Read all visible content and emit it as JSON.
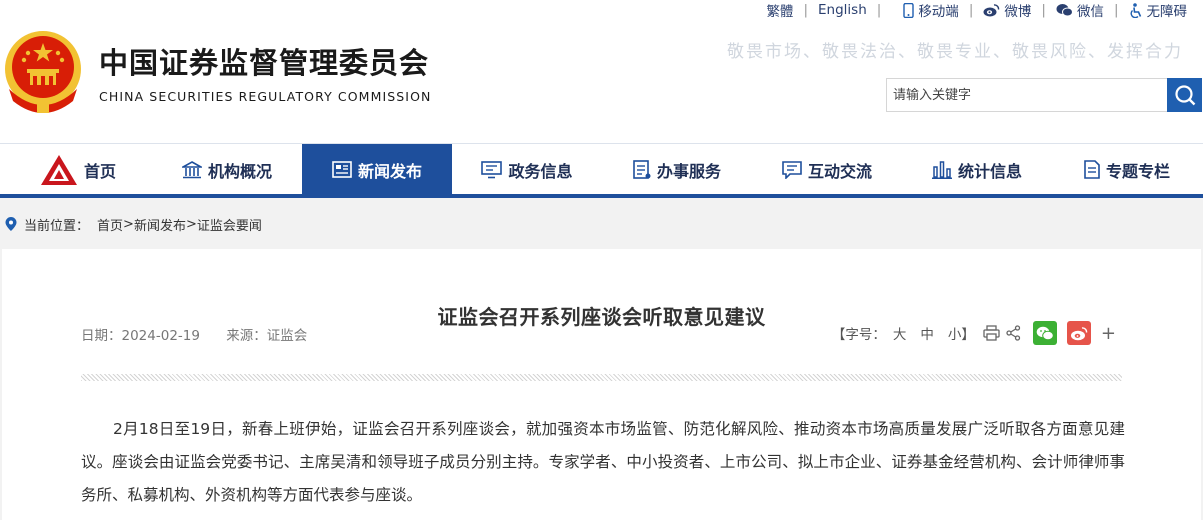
{
  "site": {
    "name_cn": "中国证券监督管理委员会",
    "name_en": "CHINA SECURITIES REGULATORY COMMISSION",
    "slogan": "敬畏市场、敬畏法治、敬畏专业、敬畏风险、发挥合力"
  },
  "toplinks": {
    "traditional": "繁體",
    "english": "English",
    "mobile": "移动端",
    "weibo": "微博",
    "wechat": "微信",
    "accessibility": "无障碍"
  },
  "search": {
    "placeholder": "请输入关键字"
  },
  "nav": {
    "home": "首页",
    "org": "机构概况",
    "news": "新闻发布",
    "gov": "政务信息",
    "service": "办事服务",
    "interact": "互动交流",
    "stats": "统计信息",
    "topics": "专题专栏",
    "active": "新闻发布"
  },
  "breadcrumb": {
    "label": "当前位置：",
    "home": "首页",
    "sep": ">",
    "news": "新闻发布",
    "current": "证监会要闻"
  },
  "article": {
    "title": "证监会召开系列座谈会听取意见建议",
    "date": "日期：2024-02-19",
    "source": "来源：证监会",
    "font_label": "【字号：",
    "font_large": "大",
    "font_medium": "中",
    "font_small": "小】",
    "more": "+",
    "paragraph": "2月18日至19日，新春上班伊始，证监会召开系列座谈会，就加强资本市场监管、防范化解风险、推动资本市场高质量发展广泛听取各方面意见建议。座谈会由证监会党委书记、主席吴清和领导班子成员分别主持。专家学者、中小投资者、上市公司、拟上市企业、证券基金经营机构、会计师律师事务所、私募机构、外资机构等方面代表参与座谈。"
  },
  "colors": {
    "nav_active": "#1e4f9c",
    "search_button": "#1f5fb0",
    "emblem_red": "#d81e06",
    "emblem_gold": "#f2c233",
    "wechat_green": "#3cb034",
    "weibo_red": "#e6544a"
  },
  "icons": [
    "national-emblem-icon",
    "mobile-icon",
    "weibo-icon",
    "wechat-icon",
    "accessibility-icon",
    "search-icon",
    "home-logo-icon",
    "building-icon",
    "newspaper-icon",
    "monitor-icon",
    "list-icon",
    "chat-icon",
    "bar-chart-icon",
    "document-icon",
    "location-pin-icon",
    "print-icon",
    "share-icon"
  ]
}
